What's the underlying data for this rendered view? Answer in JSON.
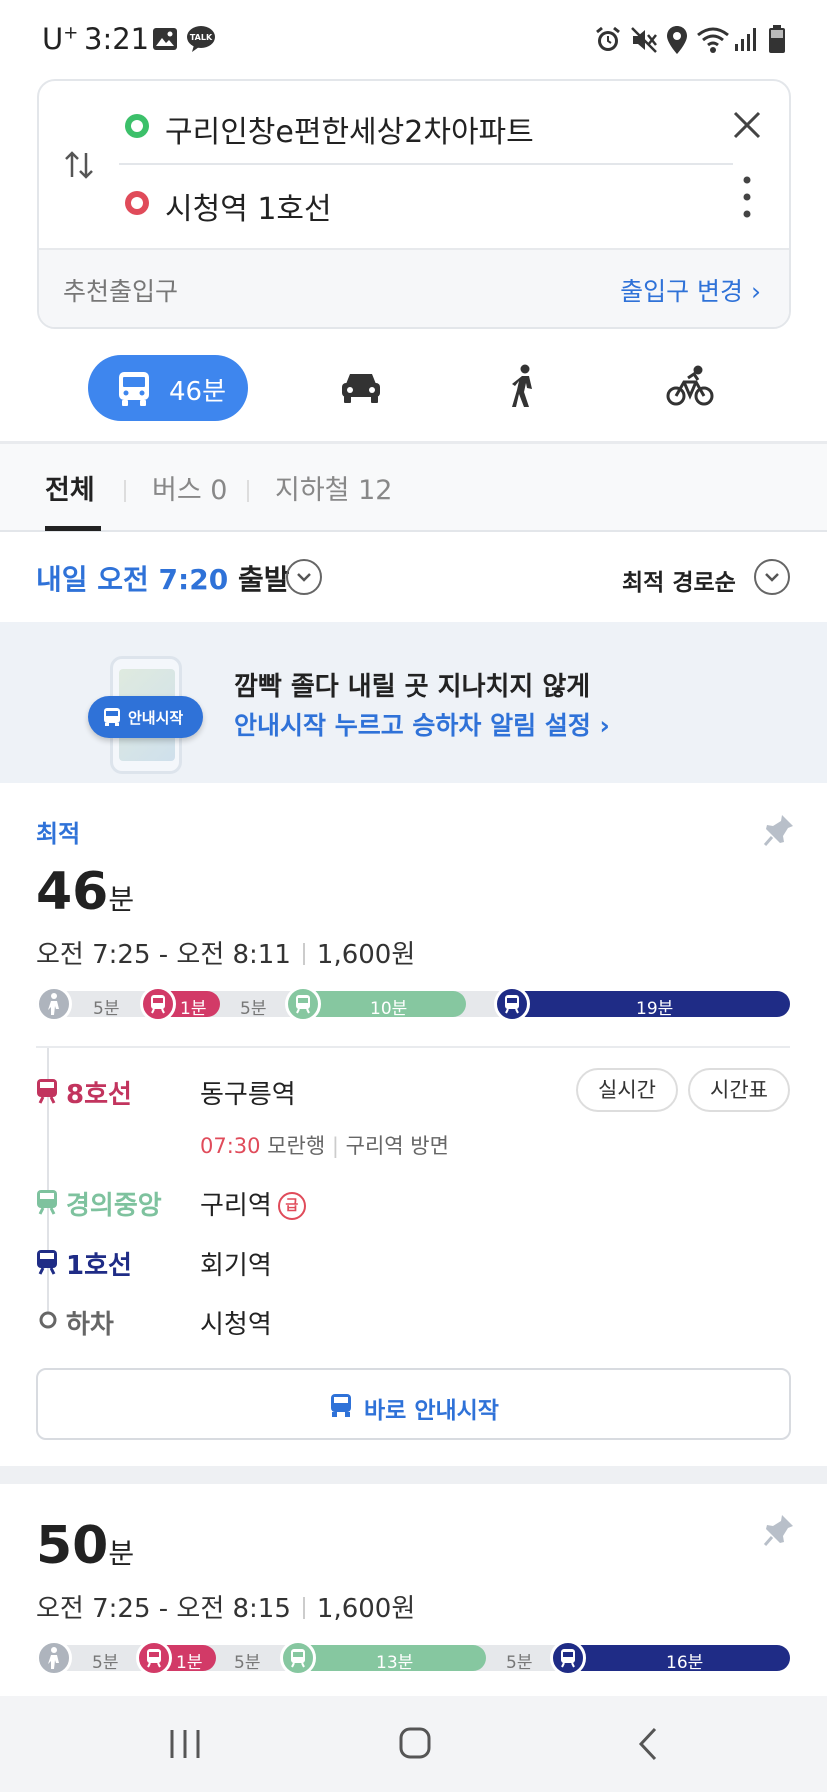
{
  "status_bar": {
    "carrier": "U",
    "carrier_sup": "+",
    "time": "3:21"
  },
  "route": {
    "origin": "구리인창e편한세상2차아파트",
    "destination": "시청역 1호선",
    "recommend_label": "추천출입구",
    "change_entrance": "출입구 변경 ›"
  },
  "modes": [
    {
      "icon": "bus-icon",
      "label": "46분",
      "active": true
    },
    {
      "icon": "car-icon",
      "active": false
    },
    {
      "icon": "walk-icon",
      "active": false
    },
    {
      "icon": "bike-icon",
      "active": false
    }
  ],
  "filters": {
    "all": "전체",
    "bus": "버스 0",
    "subway": "지하철 12"
  },
  "departure": {
    "time": "내일 오전 7:20",
    "suffix": "출발",
    "sort": "최적 경로순"
  },
  "banner": {
    "pill": "안내시작",
    "line1": "깜빡 졸다 내릴 곳 지나치지 않게",
    "line2": "안내시작 누르고 승하차 알림 설정 ›"
  },
  "result1": {
    "badge": "최적",
    "duration": "46",
    "unit": "분",
    "time_range": "오전 7:25 - 오전 8:11",
    "price": "1,600원",
    "segments": {
      "walk1": "5분",
      "line8": "1분",
      "walk2": "5분",
      "gyeongui": "10분",
      "line1": "19분"
    },
    "steps": [
      {
        "line": "8호선",
        "station": "동구릉역",
        "color": "#c2345e"
      },
      {
        "line": "경의중앙",
        "station": "구리역",
        "color": "#7ec29e"
      },
      {
        "line": "1호선",
        "station": "회기역",
        "color": "#1f2c86"
      },
      {
        "line": "하차",
        "station": "시청역",
        "color": "#666666"
      }
    ],
    "realtime": "실시간",
    "timetable": "시간표",
    "arrival_time": "07:30",
    "direction": "모란행",
    "platform": "구리역 방면",
    "express_mark": "급",
    "start_button": "바로 안내시작"
  },
  "result2": {
    "duration": "50",
    "unit": "분",
    "time_range": "오전 7:25 - 오전 8:15",
    "price": "1,600원",
    "segments": {
      "walk1": "5분",
      "line8": "1분",
      "walk2": "5분",
      "gyeongui": "13분",
      "walk3": "5분",
      "line1": "16분"
    }
  },
  "colors": {
    "accent": "#2f72d8",
    "line8": "#d23a67",
    "gyeongui": "#86c7a0",
    "line1": "#1f2c86"
  }
}
